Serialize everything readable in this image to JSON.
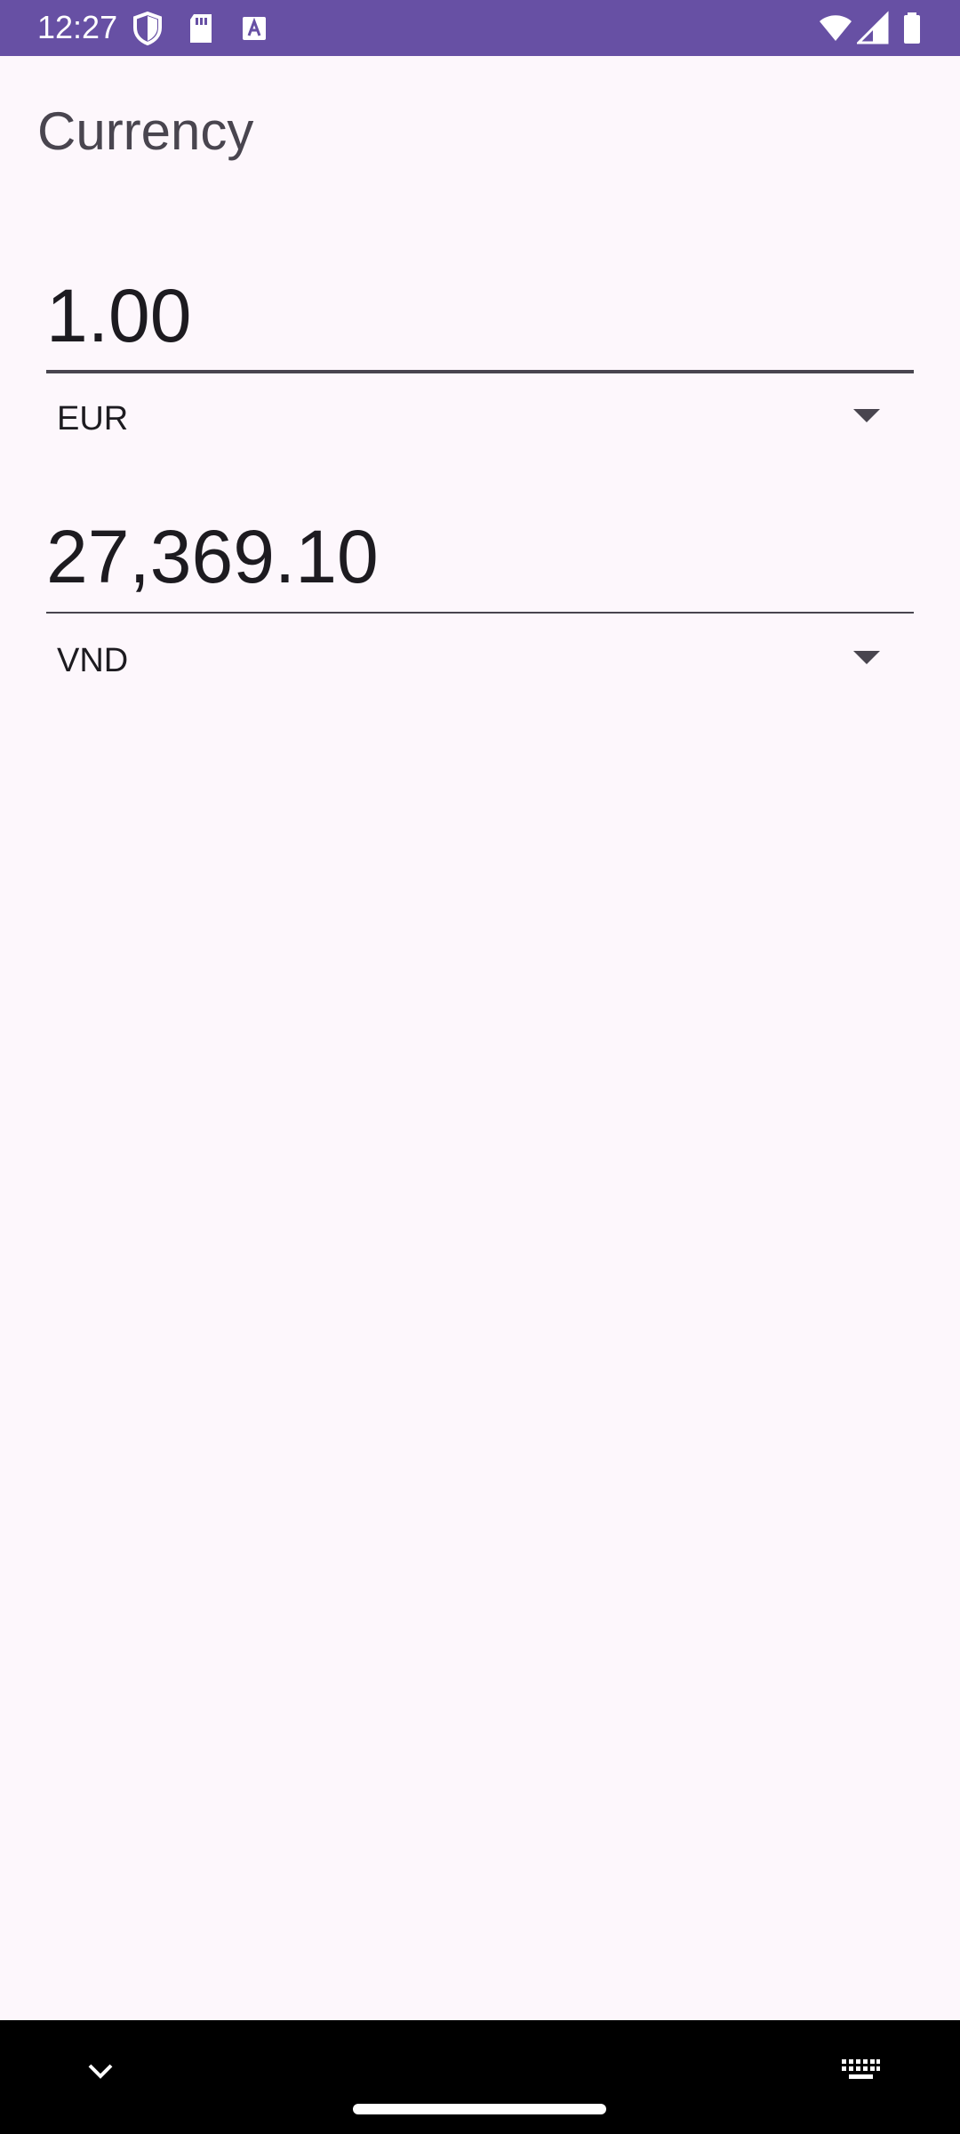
{
  "status_bar": {
    "time": "12:27",
    "background": "#6750a4",
    "left_icons": [
      "shield-icon",
      "sd-card-icon",
      "text-icon"
    ],
    "right_icons": [
      "wifi-icon",
      "signal-icon",
      "battery-icon"
    ]
  },
  "page": {
    "title": "Currency",
    "background": "#fdf7fc"
  },
  "converter": {
    "from": {
      "amount": "1.00",
      "currency": "EUR"
    },
    "to": {
      "amount": "27,369.10",
      "currency": "VND"
    }
  },
  "nav_bar": {
    "background": "#000000",
    "icons": [
      "chevron-down-icon",
      "home-handle",
      "keyboard-icon"
    ]
  }
}
